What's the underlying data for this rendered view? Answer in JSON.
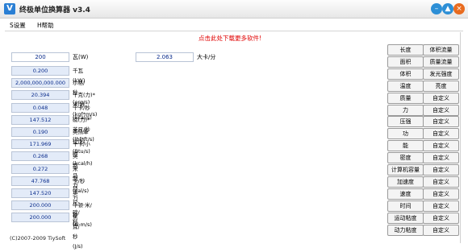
{
  "window": {
    "title": "终极单位换算器 v3.4",
    "app_icon": "V"
  },
  "menu": {
    "settings": "S设置",
    "help": "H帮助"
  },
  "promo_link": "点击此处下载更多软件!",
  "top_row": {
    "left_value": "200",
    "left_unit": "瓦(W)",
    "right_value": "2.063",
    "right_unit": "大卡/分"
  },
  "rows": [
    {
      "value": "0.200",
      "unit": "千瓦(kW)"
    },
    {
      "value": "2,000,000,000.000",
      "unit": "尔格/秒(erg/s)"
    },
    {
      "value": "20.394",
      "unit": "千克(力)*米/秒(kgf*m/s)"
    },
    {
      "value": "0.048",
      "unit": "千卡/秒(kcal/s)"
    },
    {
      "value": "147.512",
      "unit": "磅(力)*英尺/秒(lbf*ft/s)"
    },
    {
      "value": "0.190",
      "unit": "英热单位/秒(Btu/s)"
    },
    {
      "value": "171.969",
      "unit": "千卡/小时(kcal/h)"
    },
    {
      "value": "0.268",
      "unit": "英制马力"
    },
    {
      "value": "0.272",
      "unit": "米制马力"
    },
    {
      "value": "47.768",
      "unit": "卡/秒(cal/s)"
    },
    {
      "value": "147.520",
      "unit": "英尺·磅/秒"
    },
    {
      "value": "200.000",
      "unit": "牛顿·米/秒(N·m/s)"
    },
    {
      "value": "200.000",
      "unit": "焦耳/秒(J/s)"
    }
  ],
  "buttons_left": [
    "长度",
    "面积",
    "体积",
    "温度",
    "质量",
    "力",
    "压强",
    "功",
    "能",
    "密度",
    "计算机容量",
    "加速度",
    "速度",
    "时间",
    "运动粘度",
    "动力粘度"
  ],
  "buttons_right": [
    "体积流量",
    "质量流量",
    "发光强度",
    "亮度",
    "自定义",
    "自定义",
    "自定义",
    "自定义",
    "自定义",
    "自定义",
    "自定义",
    "自定义",
    "自定义",
    "自定义",
    "自定义",
    "自定义"
  ],
  "copyright": "(C)2007-2009 TiySoft"
}
